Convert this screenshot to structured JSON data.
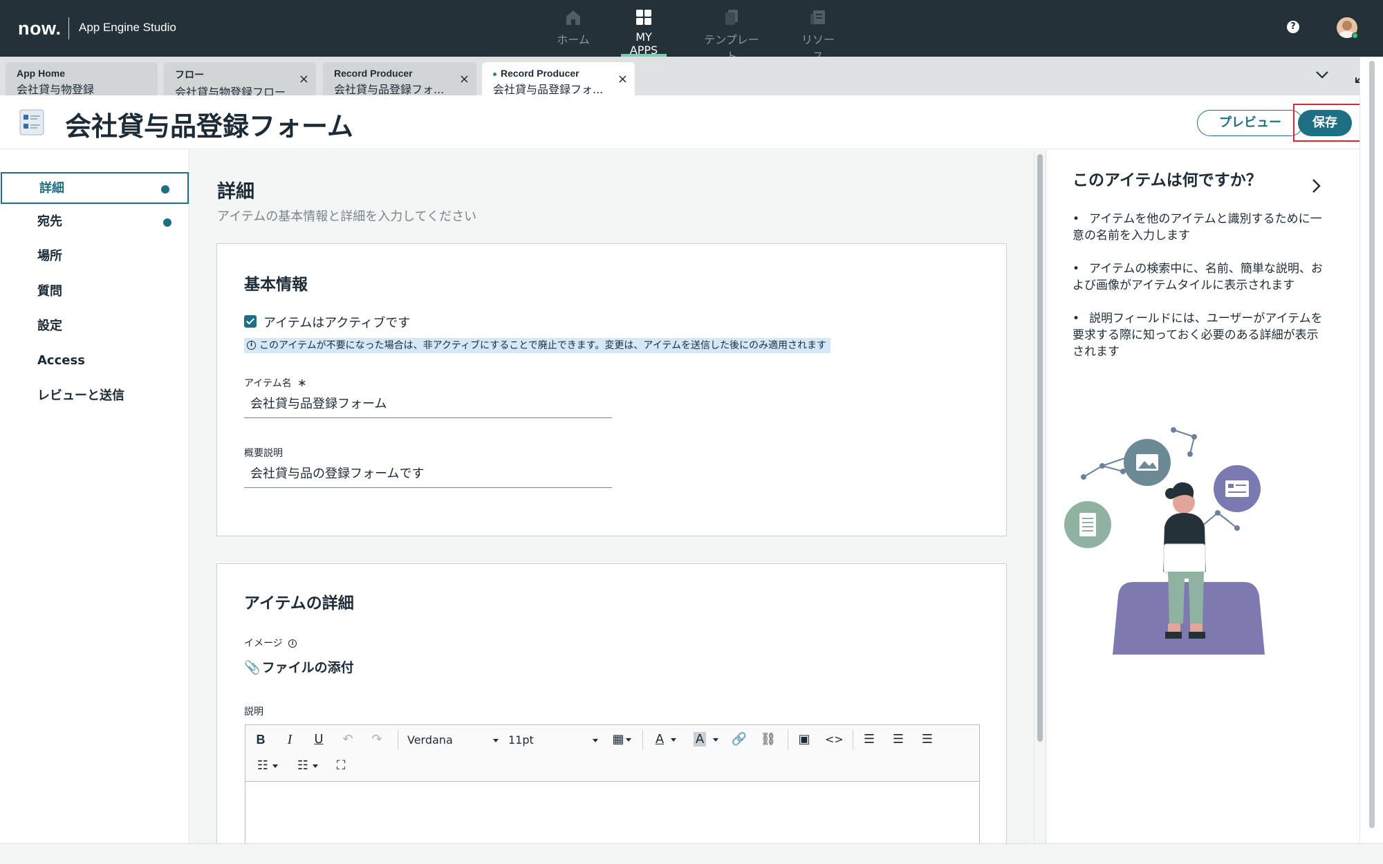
{
  "app": {
    "logo": "now.",
    "title": "App Engine Studio"
  },
  "nav": {
    "items": [
      {
        "label": "ホーム",
        "icon": "home-icon"
      },
      {
        "label": "MY APPS",
        "icon": "apps-grid-icon",
        "active": true
      },
      {
        "label": "テンプレート",
        "icon": "template-icon"
      },
      {
        "label": "リソース",
        "icon": "resource-icon"
      }
    ],
    "help": "?"
  },
  "tabs": [
    {
      "title": "App Home",
      "subtitle": "会社貸与物登録",
      "closable": false
    },
    {
      "title": "フロー",
      "subtitle": "会社貸与物登録フロー",
      "closable": true
    },
    {
      "title": "Record Producer",
      "subtitle": "会社貸与品登録フォ...",
      "closable": true
    },
    {
      "title": "Record Producer",
      "subtitle": "会社貸与品登録フォ...",
      "closable": true,
      "active": true
    }
  ],
  "header": {
    "title": "会社貸与品登録フォーム",
    "preview_label": "プレビュー",
    "save_label": "保存"
  },
  "sidebar": {
    "items": [
      {
        "label": "詳細",
        "dot": true,
        "selected": true
      },
      {
        "label": "宛先",
        "dot": true
      },
      {
        "label": "場所"
      },
      {
        "label": "質問"
      },
      {
        "label": "設定"
      },
      {
        "label": "Access"
      },
      {
        "label": "レビューと送信"
      }
    ]
  },
  "main": {
    "section_title": "詳細",
    "section_subtitle": "アイテムの基本情報と詳細を入力してください",
    "basic": {
      "title": "基本情報",
      "active_label": "アイテムはアクティブです",
      "active_checked": true,
      "info_text": "このアイテムが不要になった場合は、非アクティブにすることで廃止できます。変更は、アイテムを送信した後にのみ適用されます",
      "name_label": "アイテム名",
      "name_required": "∗",
      "name_value": "会社貸与品登録フォーム",
      "desc_label": "概要説明",
      "desc_value": "会社貸与品の登録フォームです"
    },
    "details": {
      "title": "アイテムの詳細",
      "image_label": "イメージ",
      "attach_label": "ファイルの添付",
      "description_label": "説明",
      "font_name": "Verdana",
      "font_size": "11pt"
    }
  },
  "right_panel": {
    "title": "このアイテムは何ですか？",
    "bullets": [
      "アイテムを他のアイテムと識別するために一意の名前を入力します",
      "アイテムの検索中に、名前、簡単な説明、および画像がアイテムタイルに表示されます",
      "説明フィールドには、ユーザーがアイテムを要求する際に知っておく必要のある詳細が表示されます"
    ]
  },
  "colors": {
    "nav_bg": "#233239",
    "accent": "#1f6f84",
    "highlight": "#e0242c"
  }
}
